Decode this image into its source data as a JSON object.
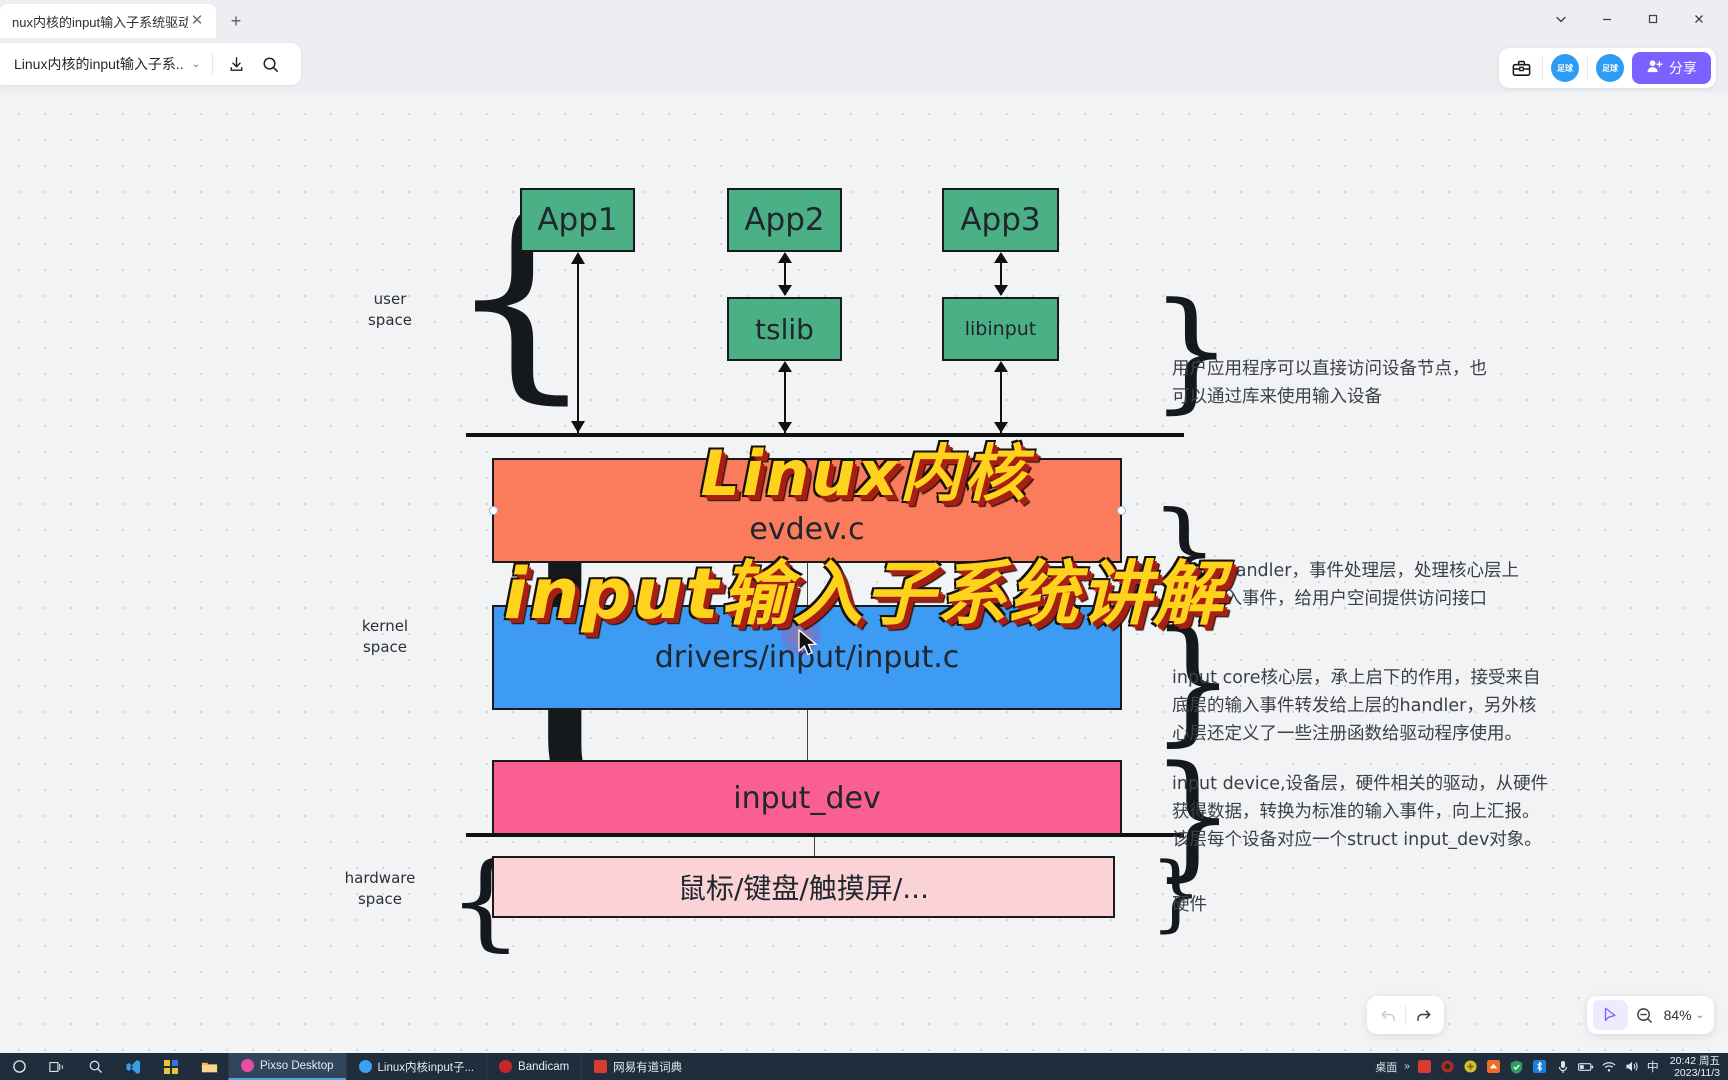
{
  "browser": {
    "tab_title": "nux内核的input输入子系统驱动框架",
    "close_icon": "close-icon",
    "new_tab_icon": "plus-icon",
    "minimize": "—",
    "maximize": "□",
    "close": "✕",
    "collapse_caret": "⌄"
  },
  "header": {
    "doc_name": "Linux内核的input输入子系..",
    "doc_caret": "⌄",
    "download_icon": "download-icon",
    "search_icon": "search-icon",
    "toolbox_icon": "toolbox-icon",
    "avatar1": "足球",
    "avatar2": "足球",
    "share_label": "分享",
    "share_icon": "person-add-icon",
    "share_color": "#7b61ff"
  },
  "diagram": {
    "boxes": {
      "app1": "App1",
      "app2": "App2",
      "app3": "App3",
      "tslib": "tslib",
      "libinput": "libinput",
      "evdev": "evdev.c",
      "input_c": "drivers/input/input.c",
      "input_dev": "input_dev",
      "hardware": "鼠标/键盘/触摸屏/..."
    },
    "colors": {
      "green": "#4cb087",
      "orange": "#fb7c5c",
      "blue": "#3d9bf4",
      "pink_dark": "#fa5f92",
      "pink_light": "#fbd3d6",
      "stroke": "#1a1a1a"
    },
    "side_labels": {
      "user_space": "user\nspace",
      "kernel_space": "kernel\nspace",
      "hardware_space": "hardware\nspace"
    },
    "annotations": {
      "user": "用户应用程序可以直接访问设备节点，也\n可以通过库来使用输入设备",
      "handler": "input Handler，事件处理层，处理核心层上\n报的输入事件，给用户空间提供访问接口",
      "core": "input core核心层，承上启下的作用，接受来自\n底层的输入事件转发给上层的handler，另外核\n心层还定义了一些注册函数给驱动程序使用。",
      "device": "input device,设备层，硬件相关的驱动，从硬件\n获得数据，转换为标准的输入事件，向上汇报。\n该层每个设备对应一个struct input_dev对象。",
      "hardware": "硬件"
    }
  },
  "overlay": {
    "line1": "Linux内核",
    "line2": "input输入子系统讲解",
    "fill": "#ffd21e",
    "shadow": "#a61e14"
  },
  "bottom_controls": {
    "undo_icon": "undo-icon",
    "redo_icon": "redo-icon",
    "select_tool_icon": "cursor-arrow-icon",
    "zoom_out_icon": "zoom-out-icon",
    "zoom_level": "84%",
    "zoom_caret": "⌄"
  },
  "taskbar": {
    "start_icon": "windows-start-icon",
    "taskview_icon": "task-view-icon",
    "search_icon": "search-icon",
    "apps": [
      {
        "name": "vscode-icon",
        "label": ""
      },
      {
        "name": "app-icon-yellow",
        "label": ""
      },
      {
        "name": "file-explorer-icon",
        "label": ""
      }
    ],
    "windows": [
      {
        "label": "Pixso Desktop",
        "color": "#e84fa0",
        "active": true
      },
      {
        "label": "Linux内核input子...",
        "color": "#3ea0f0",
        "active": false
      },
      {
        "label": "Bandicam",
        "color": "#c62828",
        "active": false
      },
      {
        "label": "网易有道词典",
        "color": "#d63c2f",
        "active": false
      }
    ],
    "tray": {
      "desktop_label": "桌面",
      "overflow": "»",
      "ime": "中",
      "time": "20:42 周五",
      "date": "2023/11/3"
    }
  }
}
